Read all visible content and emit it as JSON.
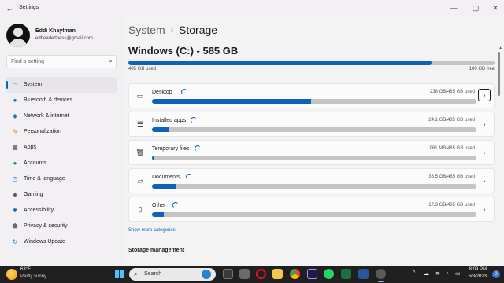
{
  "window": {
    "title": "Settings"
  },
  "user": {
    "name": "Eddi Khaytman",
    "email": "edheadedness@gmail.com"
  },
  "search": {
    "placeholder": "Find a setting"
  },
  "nav": [
    {
      "label": "System",
      "icon": "monitor-icon",
      "active": true
    },
    {
      "label": "Bluetooth & devices",
      "icon": "bluetooth-icon"
    },
    {
      "label": "Network & internet",
      "icon": "wifi-icon"
    },
    {
      "label": "Personalization",
      "icon": "brush-icon"
    },
    {
      "label": "Apps",
      "icon": "apps-icon"
    },
    {
      "label": "Accounts",
      "icon": "person-icon"
    },
    {
      "label": "Time & language",
      "icon": "globe-clock-icon"
    },
    {
      "label": "Gaming",
      "icon": "gamepad-icon"
    },
    {
      "label": "Accessibility",
      "icon": "accessibility-icon"
    },
    {
      "label": "Privacy & security",
      "icon": "shield-icon"
    },
    {
      "label": "Windows Update",
      "icon": "update-icon"
    }
  ],
  "breadcrumb": {
    "parent": "System",
    "separator": "›",
    "current": "Storage"
  },
  "drive": {
    "title": "Windows (C:) - 585 GB",
    "used_label": "485 GB used",
    "free_label": "100 GB free",
    "used_fraction": 0.829
  },
  "categories": [
    {
      "name": "Desktop",
      "size": "238 GB/485 GB used",
      "fraction": 0.49,
      "icon": "desktop-icon"
    },
    {
      "name": "Installed apps",
      "size": "24.1 GB/485 GB used",
      "fraction": 0.05,
      "icon": "list-icon"
    },
    {
      "name": "Temporary files",
      "size": "961 MB/485 GB used",
      "fraction": 0.005,
      "icon": "trash-icon"
    },
    {
      "name": "Documents",
      "size": "36.5 GB/485 GB used",
      "fraction": 0.075,
      "icon": "folder-icon"
    },
    {
      "name": "Other",
      "size": "17.3 GB/485 GB used",
      "fraction": 0.036,
      "icon": "other-file-icon"
    }
  ],
  "more_link": "Show more categories",
  "section_heading": "Storage management",
  "taskbar": {
    "weather_temp": "63°F",
    "weather_desc": "Partly sunny",
    "search_label": "Search",
    "time": "8:09 PM",
    "date": "6/8/2023",
    "notification_count": "2"
  },
  "colors": {
    "accent": "#0f61b9",
    "bar_track": "#c4c4c4",
    "taskbar": "#202020"
  }
}
